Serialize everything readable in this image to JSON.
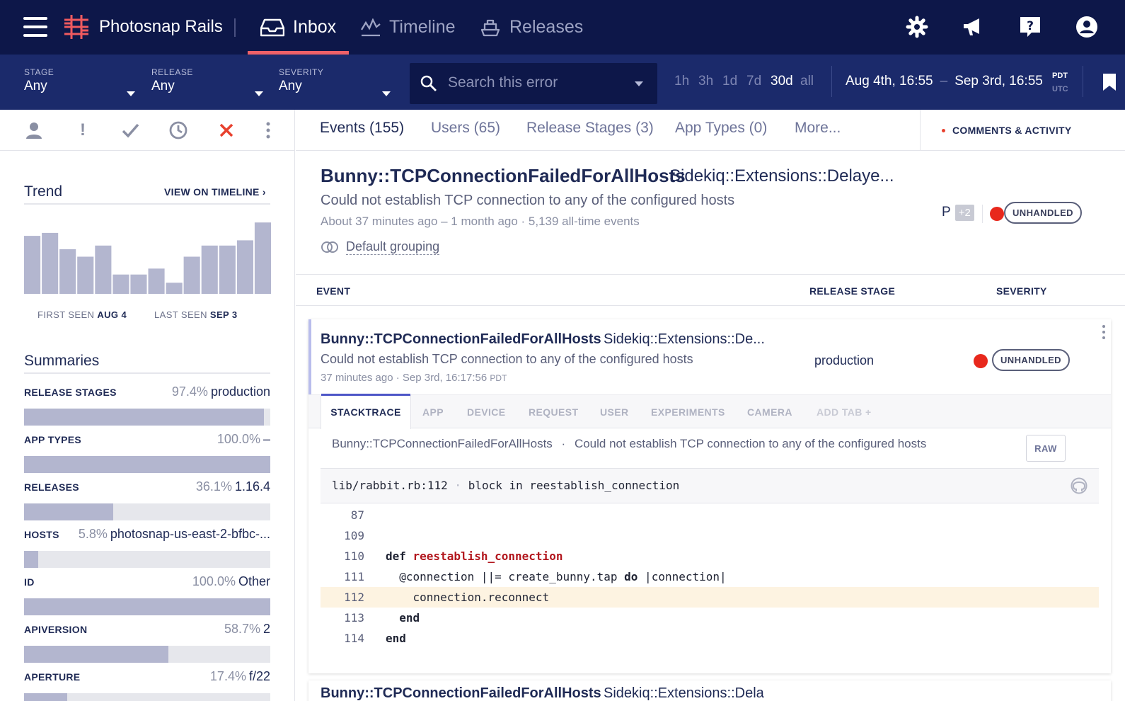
{
  "nav": {
    "app_name": "Photosnap Rails",
    "tabs": [
      {
        "label": "Inbox",
        "icon": "inbox-icon",
        "active": true
      },
      {
        "label": "Timeline",
        "icon": "timeline-icon",
        "active": false
      },
      {
        "label": "Releases",
        "icon": "ship-icon",
        "active": false
      }
    ],
    "icons": [
      "gear-icon",
      "megaphone-icon",
      "help-icon",
      "user-icon"
    ]
  },
  "filters": {
    "stage": {
      "label": "STAGE",
      "value": "Any"
    },
    "release": {
      "label": "RELEASE",
      "value": "Any"
    },
    "severity": {
      "label": "SEVERITY",
      "value": "Any"
    },
    "search_placeholder": "Search this error",
    "ranges": [
      "1h",
      "3h",
      "1d",
      "7d",
      "30d",
      "all"
    ],
    "selected_range": "30d",
    "date_from": "Aug 4th, 16:55",
    "date_sep": "–",
    "date_to": "Sep 3rd, 16:55",
    "tz_primary": "PDT",
    "tz_secondary": "UTC"
  },
  "actions": [
    "assign-icon",
    "snooze-priority-icon",
    "resolve-icon",
    "snooze-icon",
    "discard-icon",
    "more-icon"
  ],
  "trend": {
    "title": "Trend",
    "link": "VIEW ON TIMELINE ›",
    "bars": [
      78,
      82,
      60,
      50,
      65,
      26,
      26,
      34,
      15,
      50,
      65,
      65,
      72,
      96
    ],
    "first_seen_label": "FIRST SEEN",
    "first_seen": "AUG 4",
    "last_seen_label": "LAST SEEN",
    "last_seen": "SEP 3"
  },
  "summaries": {
    "title": "Summaries",
    "rows": [
      {
        "key": "RELEASE STAGES",
        "pct": "97.4%",
        "value": "production",
        "fill": 0.974
      },
      {
        "key": "APP TYPES",
        "pct": "100.0%",
        "value": "–",
        "fill": 1.0
      },
      {
        "key": "RELEASES",
        "pct": "36.1%",
        "value": "1.16.4",
        "fill": 0.361
      },
      {
        "key": "HOSTS",
        "pct": "5.8%",
        "value": "photosnap-us-east-2-bfbc-...",
        "fill": 0.058
      },
      {
        "key": "ID",
        "pct": "100.0%",
        "value": "Other",
        "fill": 1.0
      },
      {
        "key": "APIVERSION",
        "pct": "58.7%",
        "value": "2",
        "fill": 0.587
      },
      {
        "key": "APERTURE",
        "pct": "17.4%",
        "value": "f/22",
        "fill": 0.174
      }
    ]
  },
  "main_tabs": [
    {
      "label": "Events (155)",
      "active": true
    },
    {
      "label": "Users (65)",
      "active": false
    },
    {
      "label": "Release Stages (3)",
      "active": false
    },
    {
      "label": "App Types (0)",
      "active": false
    },
    {
      "label": "More...",
      "active": false
    }
  ],
  "comments_label": "COMMENTS & ACTIVITY",
  "error": {
    "class": "Bunny::TCPConnectionFailedForAllHosts",
    "context": "Sidekiq::Extensions::Delaye...",
    "message": "Could not establish TCP connection to any of the configured hosts",
    "meta": "About 37 minutes ago – 1 month ago  ·  5,139 all-time events",
    "grouping": "Default grouping",
    "user_initial": "P",
    "user_more": "+2",
    "badge": "UNHANDLED"
  },
  "table_head": {
    "event": "EVENT",
    "stage": "RELEASE STAGE",
    "severity": "SEVERITY"
  },
  "event": {
    "class": "Bunny::TCPConnectionFailedForAllHosts",
    "context": "Sidekiq::Extensions::De...",
    "message": "Could not establish TCP connection to any of the configured hosts",
    "ago": "37 minutes ago",
    "time": "Sep 3rd, 16:17:56",
    "tz": "PDT",
    "stage": "production",
    "badge": "UNHANDLED",
    "tabs": [
      "STACKTRACE",
      "APP",
      "DEVICE",
      "REQUEST",
      "USER",
      "EXPERIMENTS",
      "CAMERA",
      "ADD TAB +"
    ],
    "stack_class": "Bunny::TCPConnectionFailedForAllHosts",
    "stack_sep": "·",
    "stack_msg": "Could not establish TCP connection to any of the configured hosts",
    "raw_label": "RAW",
    "frame_file": "lib/rabbit.rb:112",
    "frame_sep": "·",
    "frame_method": "block in reestablish_connection",
    "code": [
      {
        "n": "87",
        "parts": []
      },
      {
        "n": "109",
        "parts": []
      },
      {
        "n": "110",
        "parts": [
          [
            "kw",
            "def "
          ],
          [
            "fn",
            "reestablish_connection"
          ]
        ]
      },
      {
        "n": "111",
        "parts": [
          [
            "",
            "  @connection ||= create_bunny.tap "
          ],
          [
            "kw",
            "do"
          ],
          [
            "",
            " |connection|"
          ]
        ]
      },
      {
        "n": "112",
        "parts": [
          [
            "",
            "    connection.reconnect"
          ]
        ],
        "hl": true
      },
      {
        "n": "113",
        "parts": [
          [
            "kw",
            "  end"
          ]
        ]
      },
      {
        "n": "114",
        "parts": [
          [
            "kw",
            "end"
          ]
        ]
      }
    ]
  },
  "next_event": {
    "class": "Bunny::TCPConnectionFailedForAllHosts",
    "context": "Sidekiq::Extensions::Dela"
  },
  "colors": {
    "nav_bg": "#0d1749",
    "filter_bg": "#1b2a6b",
    "accent": "#ef6168",
    "error_red": "#e8281c",
    "bar": "#b3b6cf"
  }
}
